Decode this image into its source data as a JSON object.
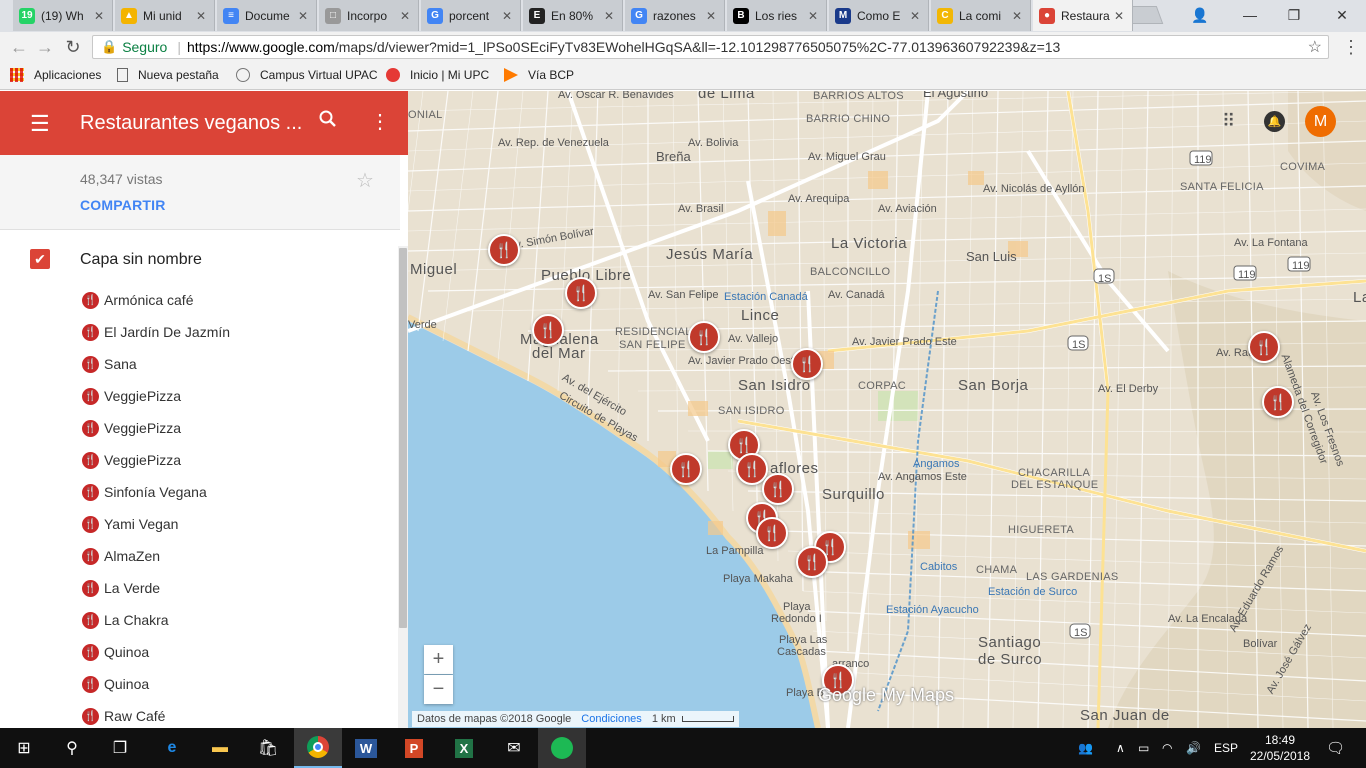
{
  "browser": {
    "tabs": [
      {
        "label": "(19) Wh",
        "icon": "whatsapp-icon",
        "color": "#25d366",
        "glyph": "19"
      },
      {
        "label": "Mi unid",
        "icon": "drive-icon",
        "color": "#f4b400",
        "glyph": "▲"
      },
      {
        "label": "Docume",
        "icon": "docs-icon",
        "color": "#4285f4",
        "glyph": "≡"
      },
      {
        "label": "Incorpo",
        "icon": "page-icon",
        "color": "#999999",
        "glyph": "□"
      },
      {
        "label": "porcent",
        "icon": "google-icon",
        "color": "#4285f4",
        "glyph": "G"
      },
      {
        "label": "En 80%",
        "icon": "site-icon",
        "color": "#222222",
        "glyph": "E"
      },
      {
        "label": "razones",
        "icon": "google-icon",
        "color": "#4285f4",
        "glyph": "G"
      },
      {
        "label": "Los ries",
        "icon": "bbc-icon",
        "color": "#000000",
        "glyph": "B"
      },
      {
        "label": "Como E",
        "icon": "site-icon",
        "color": "#1a3a8a",
        "glyph": "M"
      },
      {
        "label": "La comi",
        "icon": "site-icon",
        "color": "#f2b705",
        "glyph": "C"
      },
      {
        "label": "Restaura",
        "icon": "maps-icon",
        "color": "#db4437",
        "glyph": "●",
        "active": true
      }
    ],
    "window_controls": {
      "profile": "👤",
      "minimize": "—",
      "restore": "❐",
      "close": "✕"
    },
    "secure_label": "Seguro",
    "url_host": "https://www.google.com",
    "url_path": "/maps/d/viewer?mid=1_lPSo0SEciFyTv83EWohelHGqSA&ll=-12.101298776505075%2C-77.01396360792239&z=13",
    "bookmarks": [
      {
        "label": "Aplicaciones",
        "icon": "apps-grid-icon"
      },
      {
        "label": "Nueva pestaña",
        "icon": "page-icon"
      },
      {
        "label": "Campus Virtual UPAC",
        "icon": "campus-icon"
      },
      {
        "label": "Inicio | Mi UPC",
        "icon": "upc-icon"
      },
      {
        "label": "Vía BCP",
        "icon": "bcp-icon"
      }
    ]
  },
  "sidebar": {
    "title": "Restaurantes veganos ...",
    "views": "48,347 vistas",
    "share": "COMPARTIR",
    "layer_name": "Capa sin nombre",
    "places": [
      "Armónica café",
      "El Jardín De Jazmín",
      "Sana",
      "VeggiePizza",
      "VeggiePizza",
      "VeggiePizza",
      "Sinfonía Vegana",
      "Yami Vegan",
      "AlmaZen",
      "La Verde",
      "La Chakra",
      "Quinoa",
      "Quinoa",
      "Raw Café"
    ]
  },
  "map": {
    "avatar_letter": "M",
    "attribution": "Datos de mapas ©2018 Google",
    "terms": "Condiciones",
    "scale": "1 km",
    "watermark": "Google My Maps",
    "zoom_in": "+",
    "zoom_out": "−",
    "labels": {
      "lima": "de Lima",
      "barrios_altos": "BARRIOS ALTOS",
      "el_agustino": "El Agustino",
      "barrio_chino": "BARRIO CHINO",
      "colonial": "ONIAL",
      "brena": "Breña",
      "av_bolivia": "Av. Bolivia",
      "av_miguel_grau": "Av. Miguel Grau",
      "av_rep_venezuela": "Av. Rep. de Venezuela",
      "av_oscar_benavides": "Av. Oscar R. Benavides",
      "av_nicolas_ayllon": "Av. Nicolás de Ayllón",
      "covima": "COVIMA",
      "santa_felicia": "SANTA FELICIA",
      "av_la_fontana": "Av. La Fontana",
      "la_victoria": "La Victoria",
      "jesus_maria": "Jesús María",
      "miguel": "Miguel",
      "pueblo_libre": "Pueblo Libre",
      "balconcillo": "BALCONCILLO",
      "san_luis": "San Luis",
      "av_simon_bolivar": "Av. Simón Bolívar",
      "av_brasil": "Av. Brasil",
      "av_san_felipe": "Av. San Felipe",
      "estacion_canada": "Estación Canadá",
      "av_canada": "Av. Canadá",
      "lince": "Lince",
      "magdalena": "Magdalena",
      "del_mar": "del Mar",
      "residencial": "RESIDENCIAL",
      "san_felipe": "SAN FELIPE",
      "av_javier_prado": "Av. Javier Prado Este",
      "av_javier_prado_oeste": "Av. Javier Prado Oeste",
      "san_isidro": "San Isidro",
      "corpac": "CORPAC",
      "san_borja": "San Borja",
      "verde": "Verde",
      "av_del_ejercito": "Av. del Ejército",
      "circuito_playas": "Circuito de Playas",
      "san_isidro_caps": "SAN ISIDRO",
      "av_el_derby": "Av. El Derby",
      "av_raul": "Av. Raúl",
      "miraflores": "aflores",
      "surquillo": "Surquillo",
      "angamos": "Angamos",
      "av_angamos_este": "Av. Angamos Este",
      "chacarilla": "CHACARILLA",
      "del_estanque": "DEL ESTANQUE",
      "la_pampilla": "La Pampilla",
      "playa_makaha": "Playa Makaha",
      "higuereta": "HIGUERETA",
      "chama": "CHAMA",
      "cabitos": "Cabitos",
      "las_gardenias": "LAS GARDENIAS",
      "estacion_surco": "Estación de Surco",
      "estacion_ayacucho": "Estación Ayacucho",
      "playa_redondo": "Playa",
      "playa_redondo2": "Redondo I",
      "playa_cascadas": "Playa Las",
      "playa_cascadas2": "Cascadas",
      "santiago": "Santiago",
      "de_surco": "de Surco",
      "barranco": "arranco",
      "playa_b": "Playa B",
      "san_juan": "San Juan de",
      "av_vallejo": "Av. Vallejo",
      "av_aviacion": "Av. Aviación",
      "av_arequipa": "Av. Arequipa",
      "av_eduardo_ramos": "Av. Eduardo Ramos",
      "av_jose_galvez": "Av. José Gálvez",
      "bolivar": "Bolívar",
      "av_la_encalada": "Av. La Encalada",
      "road_119a": "119",
      "road_119b": "119",
      "road_1sa": "1S",
      "road_1sb": "1S",
      "road_1sc": "1S",
      "road_1sd": "1S",
      "road_1sc_two": "1S",
      "road_119c": "119",
      "av_la_molina": "Alameda del Corregidor",
      "av_los_fresnos": "Av. Los Fresnos",
      "la": "La"
    }
  },
  "taskbar": {
    "language": "ESP",
    "time": "18:49",
    "date": "22/05/2018"
  }
}
